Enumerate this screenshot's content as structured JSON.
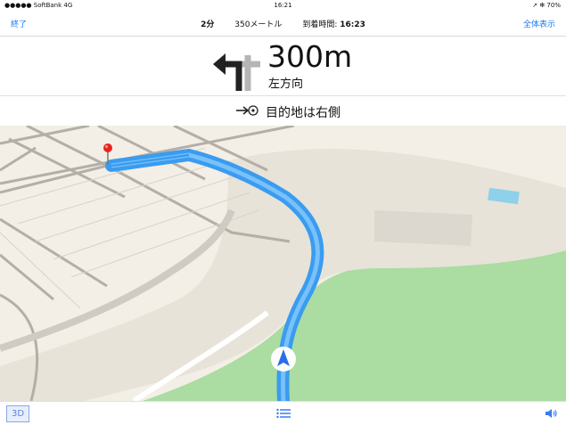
{
  "status": {
    "carrier": "●●●●● SoftBank  4G",
    "time": "16:21",
    "battery": "➚ ✻ 70%"
  },
  "nav": {
    "end_label": "終了",
    "eta_minutes": "2分",
    "distance_remaining": "350メートル",
    "arrival_prefix": "到着時間:",
    "arrival_time": "16:23",
    "overview_label": "全体表示"
  },
  "instruction": {
    "distance": "300m",
    "direction": "左方向",
    "icon": "turn-left-arrow"
  },
  "destination": {
    "label": "目的地は右側",
    "icon": "destination-right-icon"
  },
  "map": {
    "pin_color": "#e8211c",
    "route_color": "#3a9cf0",
    "park_color": "#a9dda0",
    "marker_color": "#2b6fe6"
  },
  "bottom": {
    "mode_label": "3D",
    "list_icon": "list-icon",
    "volume_icon": "speaker-icon"
  }
}
